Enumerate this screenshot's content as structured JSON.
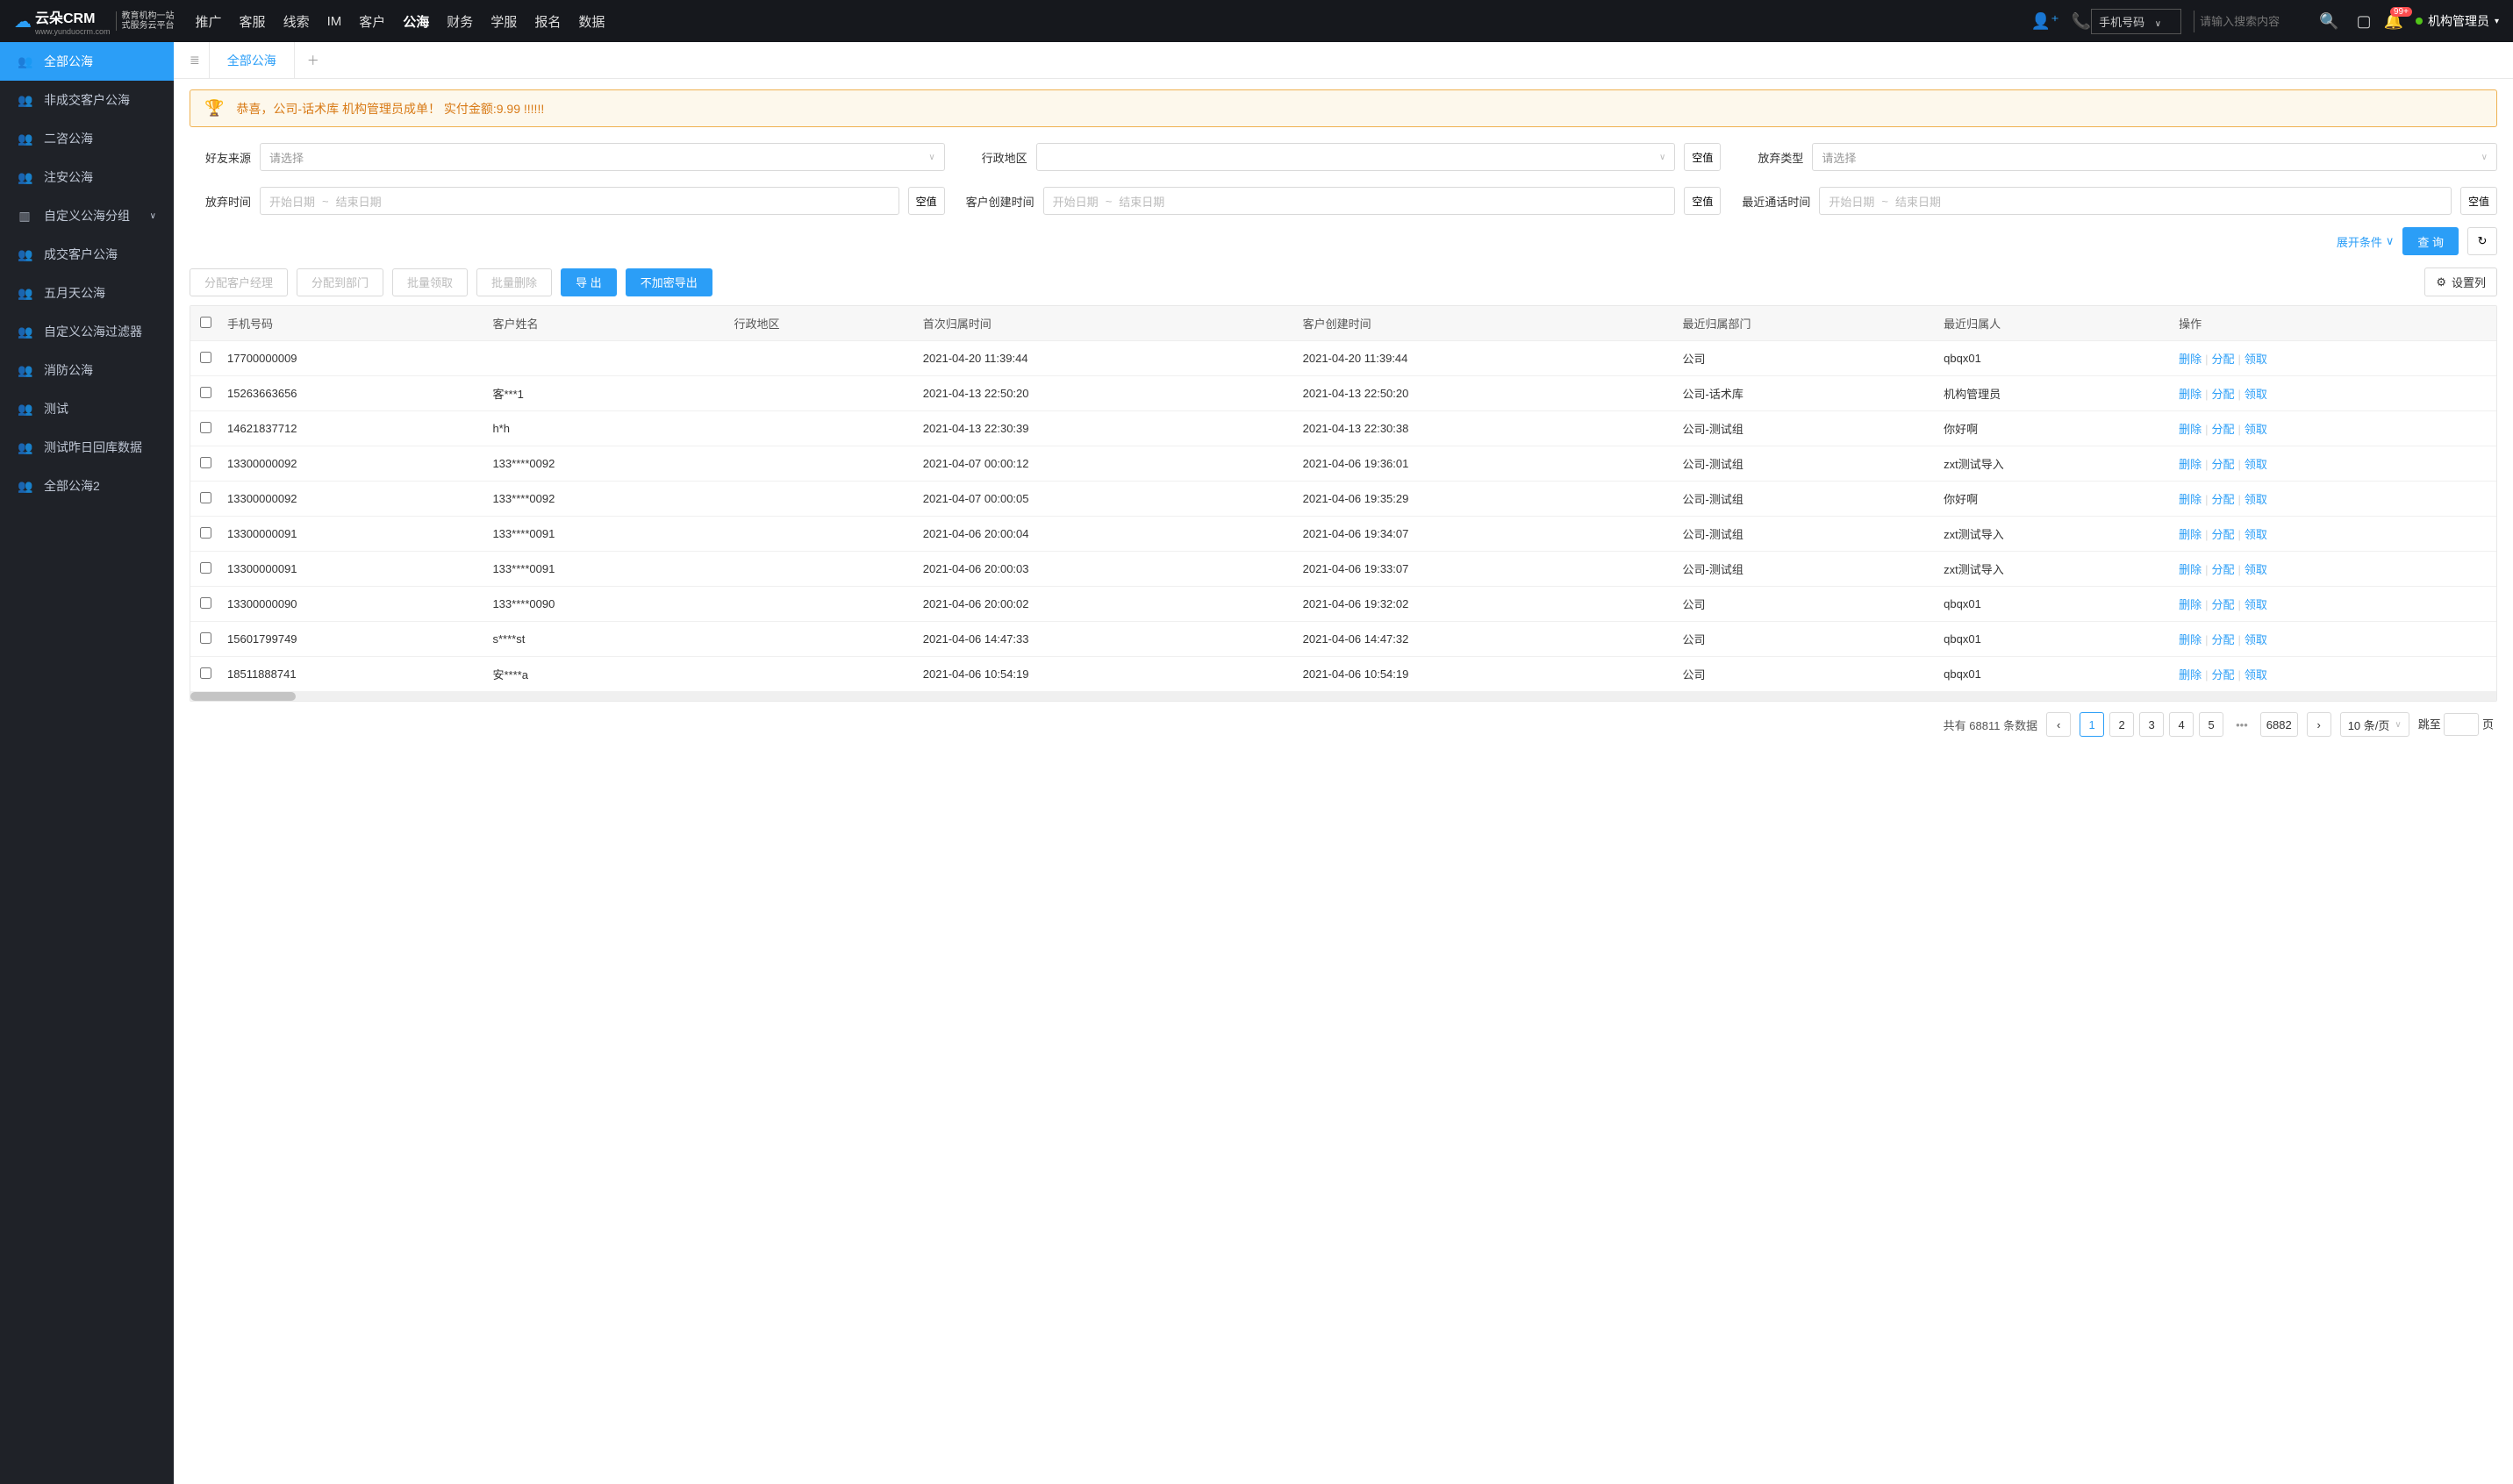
{
  "logo": {
    "brand": "云朵CRM",
    "sub1": "教育机构一站",
    "sub2": "式服务云平台",
    "url": "www.yunduocrm.com"
  },
  "nav": {
    "items": [
      "推广",
      "客服",
      "线索",
      "IM",
      "客户",
      "公海",
      "财务",
      "学服",
      "报名",
      "数据"
    ],
    "active_index": 5
  },
  "header": {
    "search_type": "手机号码",
    "search_placeholder": "请输入搜索内容",
    "badge": "99+",
    "user": "机构管理员"
  },
  "sidebar": {
    "items": [
      {
        "label": "全部公海",
        "icon": "👥",
        "active": true
      },
      {
        "label": "非成交客户公海",
        "icon": "👥"
      },
      {
        "label": "二咨公海",
        "icon": "👥"
      },
      {
        "label": "注安公海",
        "icon": "👥"
      },
      {
        "label": "自定义公海分组",
        "icon": "▥",
        "caret": true
      },
      {
        "label": "成交客户公海",
        "icon": "👥"
      },
      {
        "label": "五月天公海",
        "icon": "👥"
      },
      {
        "label": "自定义公海过滤器",
        "icon": "👥"
      },
      {
        "label": "消防公海",
        "icon": "👥"
      },
      {
        "label": "测试",
        "icon": "👥"
      },
      {
        "label": "测试昨日回库数据",
        "icon": "👥"
      },
      {
        "label": "全部公海2",
        "icon": "👥"
      }
    ]
  },
  "tabs": {
    "active": "全部公海"
  },
  "alert": "恭喜，公司-话术库  机构管理员成单！  实付金额:9.99 !!!!!!",
  "filters": {
    "friend_source_label": "好友来源",
    "friend_source_ph": "请选择",
    "region_label": "行政地区",
    "region_ph": "",
    "abandon_type_label": "放弃类型",
    "abandon_type_ph": "请选择",
    "abandon_time_label": "放弃时间",
    "create_time_label": "客户创建时间",
    "call_time_label": "最近通话时间",
    "start_ph": "开始日期",
    "end_ph": "结束日期",
    "null_label": "空值",
    "expand": "展开条件",
    "query": "查 询"
  },
  "toolbar": {
    "assign_mgr": "分配客户经理",
    "assign_dept": "分配到部门",
    "batch_claim": "批量领取",
    "batch_del": "批量删除",
    "export": "导 出",
    "export_plain": "不加密导出",
    "set_cols": "设置列"
  },
  "table": {
    "columns": [
      "手机号码",
      "客户姓名",
      "行政地区",
      "首次归属时间",
      "客户创建时间",
      "最近归属部门",
      "最近归属人",
      "操作"
    ],
    "ops": {
      "delete": "删除",
      "assign": "分配",
      "claim": "领取"
    },
    "rows": [
      {
        "phone": "17700000009",
        "name": "",
        "region": "",
        "first": "2021-04-20 11:39:44",
        "create": "2021-04-20 11:39:44",
        "dept": "公司",
        "owner": "qbqx01"
      },
      {
        "phone": "15263663656",
        "name": "客***1",
        "region": "",
        "first": "2021-04-13 22:50:20",
        "create": "2021-04-13 22:50:20",
        "dept": "公司-话术库",
        "owner": "机构管理员"
      },
      {
        "phone": "14621837712",
        "name": "h*h",
        "region": "",
        "first": "2021-04-13 22:30:39",
        "create": "2021-04-13 22:30:38",
        "dept": "公司-测试组",
        "owner": "你好啊"
      },
      {
        "phone": "13300000092",
        "name": "133****0092",
        "region": "",
        "first": "2021-04-07 00:00:12",
        "create": "2021-04-06 19:36:01",
        "dept": "公司-测试组",
        "owner": "zxt测试导入"
      },
      {
        "phone": "13300000092",
        "name": "133****0092",
        "region": "",
        "first": "2021-04-07 00:00:05",
        "create": "2021-04-06 19:35:29",
        "dept": "公司-测试组",
        "owner": "你好啊"
      },
      {
        "phone": "13300000091",
        "name": "133****0091",
        "region": "",
        "first": "2021-04-06 20:00:04",
        "create": "2021-04-06 19:34:07",
        "dept": "公司-测试组",
        "owner": "zxt测试导入"
      },
      {
        "phone": "13300000091",
        "name": "133****0091",
        "region": "",
        "first": "2021-04-06 20:00:03",
        "create": "2021-04-06 19:33:07",
        "dept": "公司-测试组",
        "owner": "zxt测试导入"
      },
      {
        "phone": "13300000090",
        "name": "133****0090",
        "region": "",
        "first": "2021-04-06 20:00:02",
        "create": "2021-04-06 19:32:02",
        "dept": "公司",
        "owner": "qbqx01"
      },
      {
        "phone": "15601799749",
        "name": "s****st",
        "region": "",
        "first": "2021-04-06 14:47:33",
        "create": "2021-04-06 14:47:32",
        "dept": "公司",
        "owner": "qbqx01"
      },
      {
        "phone": "18511888741",
        "name": "安****a",
        "region": "",
        "first": "2021-04-06 10:54:19",
        "create": "2021-04-06 10:54:19",
        "dept": "公司",
        "owner": "qbqx01"
      }
    ]
  },
  "pagination": {
    "total_prefix": "共有",
    "total": "68811",
    "total_suffix": "条数据",
    "pages": [
      "1",
      "2",
      "3",
      "4",
      "5"
    ],
    "last": "6882",
    "size": "10 条/页",
    "jump_prefix": "跳至",
    "jump_suffix": "页"
  }
}
